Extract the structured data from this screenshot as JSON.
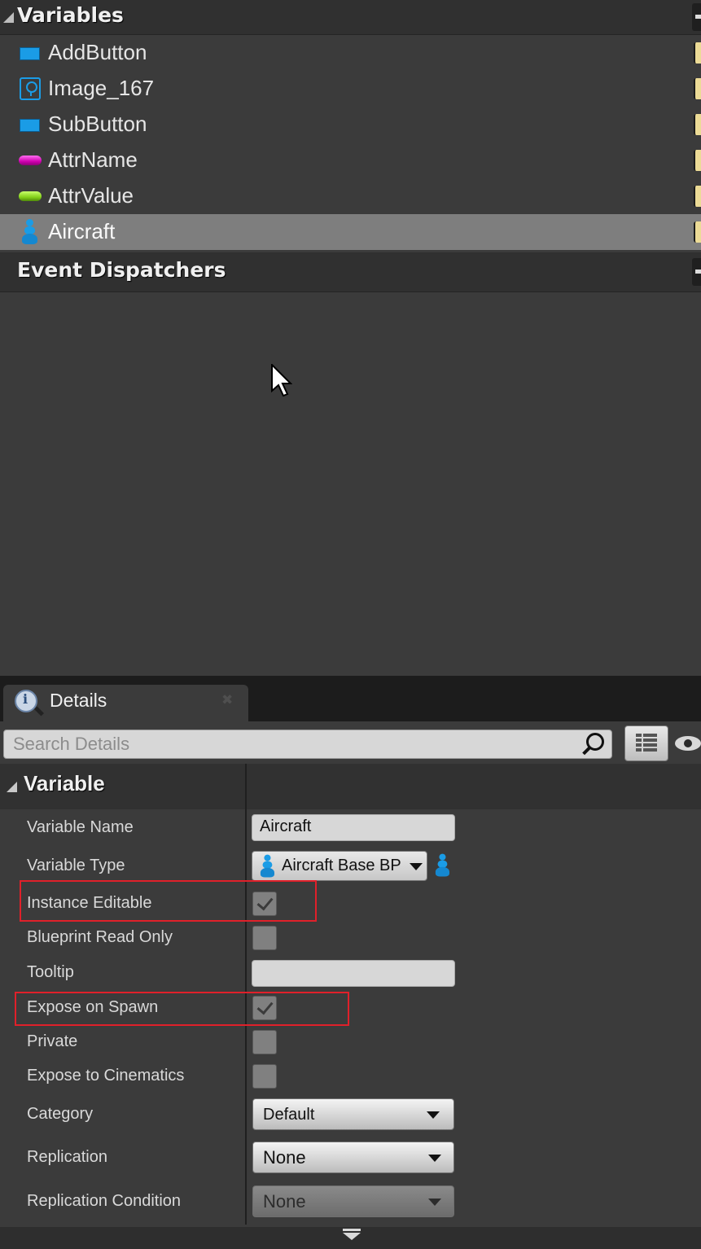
{
  "blueprint": {
    "variables_header": "Variables",
    "variables": [
      {
        "label": "AddButton",
        "icon": "button-widget-icon"
      },
      {
        "label": "Image_167",
        "icon": "image-widget-icon"
      },
      {
        "label": "SubButton",
        "icon": "button-widget-icon"
      },
      {
        "label": "AttrName",
        "icon": "text-pill-icon",
        "color": "#e000c0"
      },
      {
        "label": "AttrValue",
        "icon": "text-pill-icon",
        "color": "#8cd21a"
      },
      {
        "label": "Aircraft",
        "icon": "pawn-icon",
        "selected": true
      }
    ],
    "dispatchers_header": "Event Dispatchers"
  },
  "details": {
    "tab_label": "Details",
    "search_placeholder": "Search Details",
    "category": "Variable",
    "props": {
      "variable_name": {
        "label": "Variable Name",
        "value": "Aircraft"
      },
      "variable_type": {
        "label": "Variable Type",
        "value": "Aircraft Base BP"
      },
      "instance_editable": {
        "label": "Instance Editable",
        "checked": true
      },
      "blueprint_read_only": {
        "label": "Blueprint Read Only",
        "checked": false
      },
      "tooltip": {
        "label": "Tooltip",
        "value": ""
      },
      "expose_on_spawn": {
        "label": "Expose on Spawn",
        "checked": true
      },
      "private": {
        "label": "Private",
        "checked": false
      },
      "expose_to_cinematics": {
        "label": "Expose to Cinematics",
        "checked": false
      },
      "category": {
        "label": "Category",
        "value": "Default"
      },
      "replication": {
        "label": "Replication",
        "value": "None"
      },
      "replication_condition": {
        "label": "Replication Condition",
        "value": "None",
        "disabled": true
      }
    }
  },
  "colors": {
    "selection": "#7e7e7e",
    "widget_blue": "#1a9ce6",
    "highlight_red": "#e0202a"
  }
}
